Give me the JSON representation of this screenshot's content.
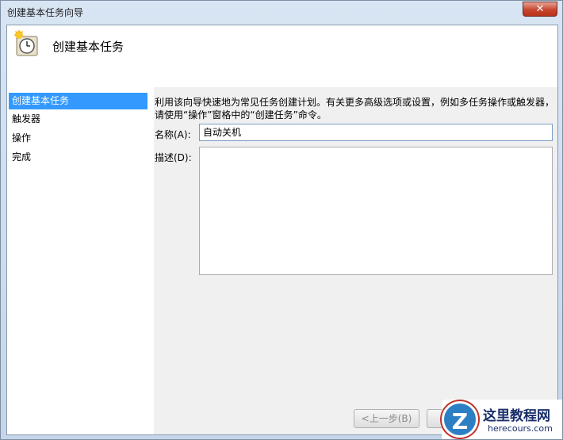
{
  "window": {
    "title": "创建基本任务向导",
    "close_label": "✕"
  },
  "header": {
    "title": "创建基本任务"
  },
  "nav": {
    "items": [
      {
        "label": "创建基本任务"
      },
      {
        "label": "触发器"
      },
      {
        "label": "操作"
      },
      {
        "label": "完成"
      }
    ]
  },
  "main": {
    "description": "利用该向导快速地为常见任务创建计划。有关更多高级选项或设置，例如多任务操作或触发器，请使用“操作”窗格中的“创建任务”命令。",
    "name_label": "名称(A):",
    "name_value": "自动关机",
    "desc_label": "描述(D):",
    "desc_value": ""
  },
  "footer": {
    "back_label": "<上一步(B)"
  },
  "watermark": {
    "badge": "Z",
    "title": "这里教程网",
    "subtitle": "herecours.com"
  }
}
